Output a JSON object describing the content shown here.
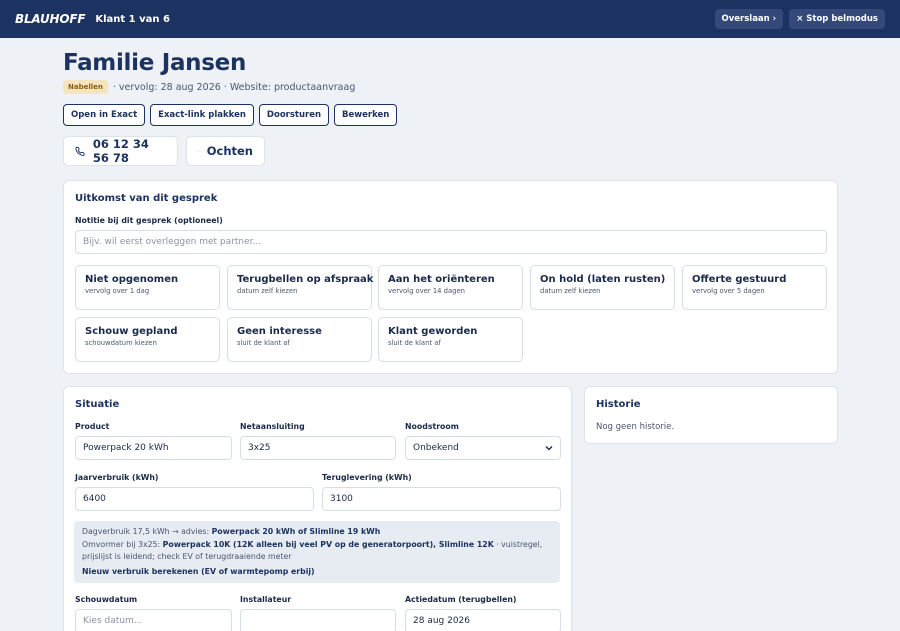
{
  "topbar": {
    "logo": "BLAUHOFF",
    "title": "Klant 1 van 6",
    "skip_label": "Overslaan ›",
    "stop_label": "× Stop belmodus"
  },
  "customer": {
    "name": "Familie Jansen",
    "badge": "Nabellen",
    "meta": "· vervolg: 28 aug 2026 · Website: productaanvraag"
  },
  "actions": {
    "open_exact": "Open in Exact",
    "paste_link": "Exact-link plakken",
    "forward": "Doorsturen",
    "edit": "Bewerken"
  },
  "contact": {
    "phone": "06 12 34 56 78",
    "daypart": "Ochten"
  },
  "outcome": {
    "title": "Uitkomst van dit gesprek",
    "note_label": "Notitie bij dit gesprek (optioneel)",
    "note_placeholder": "Bijv. wil eerst overleggen met partner...",
    "options": [
      {
        "title": "Niet opgenomen",
        "sub": "vervolg over 1 dag"
      },
      {
        "title": "Terugbellen op afspraak",
        "sub": "datum zelf kiezen"
      },
      {
        "title": "Aan het oriënteren",
        "sub": "vervolg over 14 dagen"
      },
      {
        "title": "On hold (laten rusten)",
        "sub": "datum zelf kiezen"
      },
      {
        "title": "Offerte gestuurd",
        "sub": "vervolg over 5 dagen"
      },
      {
        "title": "Schouw gepland",
        "sub": "schouwdatum kiezen"
      },
      {
        "title": "Geen interesse",
        "sub": "sluit de klant af"
      },
      {
        "title": "Klant geworden",
        "sub": "sluit de klant af"
      }
    ]
  },
  "situation": {
    "title": "Situatie",
    "product_label": "Product",
    "product_value": "Powerpack 20 kWh",
    "grid_label": "Netaansluiting",
    "grid_value": "3x25",
    "backup_label": "Noodstroom",
    "backup_value": "Onbekend",
    "annual_label": "Jaarverbruik (kWh)",
    "annual_value": "6400",
    "feedin_label": "Teruglevering (kWh)",
    "feedin_value": "3100",
    "advice_line1_prefix": "Dagverbruik 17,5 kWh → advies: ",
    "advice_line1_strong": "Powerpack 20 kWh of Slimline 19 kWh",
    "advice_line2_prefix": "Omvormer bij 3x25: ",
    "advice_line2_strong": "Powerpack 10K (12K alleen bij veel PV op de generatorpoort), Slimline 12K",
    "advice_line2_suffix": " · vuistregel, prijslijst is leidend; check EV of terugdraaiende meter",
    "recalc_link": "Nieuw verbruik berekenen (EV of warmtepomp erbij)",
    "survey_label": "Schouwdatum",
    "survey_placeholder": "Kies datum...",
    "installer_label": "Installateur",
    "installer_value": "",
    "action_label": "Actiedatum (terugbellen)",
    "action_value": "28 aug 2026"
  },
  "history": {
    "title": "Historie",
    "empty": "Nog geen historie."
  }
}
